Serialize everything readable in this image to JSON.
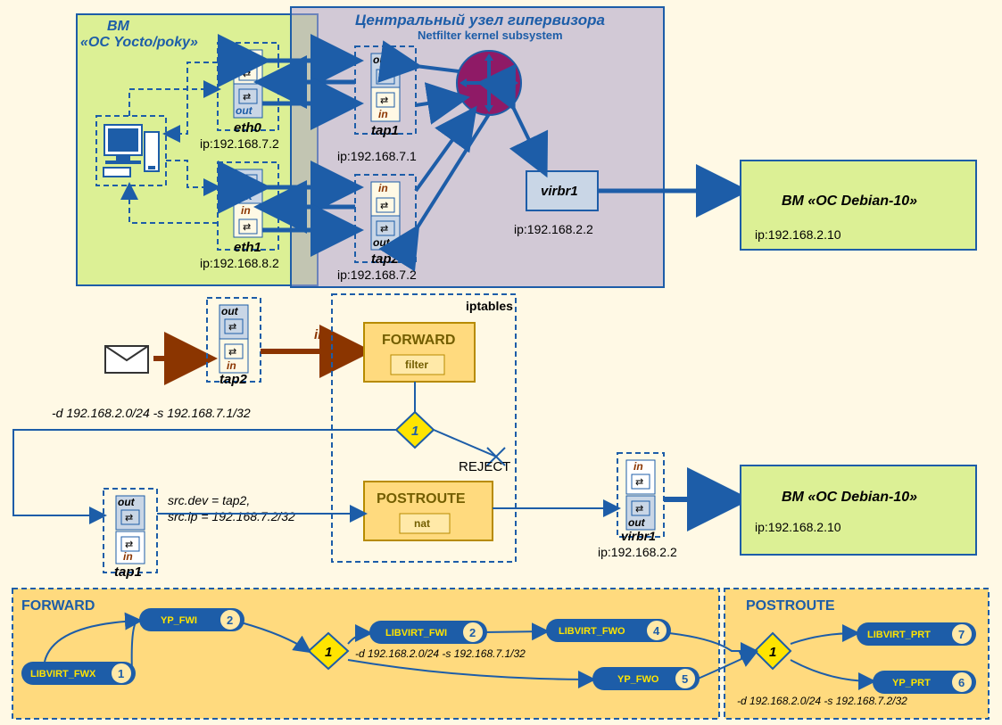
{
  "vm_yocto": {
    "title1": "ВМ",
    "title2": "«ОС Yocto/poky»",
    "eth0": {
      "in": "in",
      "out": "out",
      "name": "eth0",
      "ip": "ip:192.168.7.2"
    },
    "eth1": {
      "in": "in",
      "out": "out",
      "name": "eth1",
      "ip": "ip:192.168.8.2"
    }
  },
  "hypervisor": {
    "title": "Центральный узел гипервизора",
    "subtitle": "Netfilter kernel subsystem",
    "tap1": {
      "in": "in",
      "out": "out",
      "name": "tap1",
      "ip": "ip:192.168.7.1"
    },
    "tap2": {
      "in": "in",
      "out": "out",
      "name": "tap2",
      "ip": "ip:192.168.7.2"
    },
    "virbr1": {
      "name": "virbr1",
      "ip": "ip:192.168.2.2"
    }
  },
  "vm_debian_top": {
    "title": "ВМ «ОС Debian-10»",
    "ip": "ip:192.168.2.10"
  },
  "vm_debian_bottom": {
    "title": "ВМ «ОС Debian-10»",
    "ip": "ip:192.168.2.10"
  },
  "flow": {
    "in1": "in",
    "in2": "in",
    "tap2": {
      "in": "in",
      "out": "out",
      "name": "tap2"
    },
    "tap1": {
      "in": "in",
      "out": "out",
      "name": "tap1"
    },
    "virbr1": {
      "in": "in",
      "out": "out",
      "name": "virbr1",
      "ip": "ip:192.168.2.2"
    },
    "rule1": "-d 192.168.2.0/24 -s 192.168.7.1/32",
    "src_note": "src.dev = tap2,\nsrc.ip = 192.168.7.2/32",
    "reject": "REJECT",
    "decision1": "1"
  },
  "iptables": {
    "label": "iptables",
    "forward": {
      "title": "FORWARD",
      "sub": "filter"
    },
    "postroute": {
      "title": "POSTROUTE",
      "sub": "nat"
    }
  },
  "chains": {
    "forward_label": "FORWARD",
    "postroute_label": "POSTROUTE",
    "d1": "1",
    "d2": "1",
    "nodes": {
      "libvirt_fwx": {
        "t": "LIBVIRT_FWX",
        "n": "1"
      },
      "yp_fwi": {
        "t": "YP_FWI",
        "n": "2"
      },
      "libvirt_fwi": {
        "t": "LIBVIRT_FWI",
        "n": "2"
      },
      "libvirt_fwo": {
        "t": "LIBVIRT_FWO",
        "n": "4"
      },
      "yp_fwo": {
        "t": "YP_FWO",
        "n": "5"
      },
      "yp_prt": {
        "t": "YP_PRT",
        "n": "6"
      },
      "libvirt_prt": {
        "t": "LIBVIRT_PRT",
        "n": "7"
      }
    },
    "rule_mid": "-d 192.168.2.0/24 -s 192.168.7.1/32",
    "rule_right": "-d 192.168.2.0/24 -s 192.168.7.2/32"
  }
}
